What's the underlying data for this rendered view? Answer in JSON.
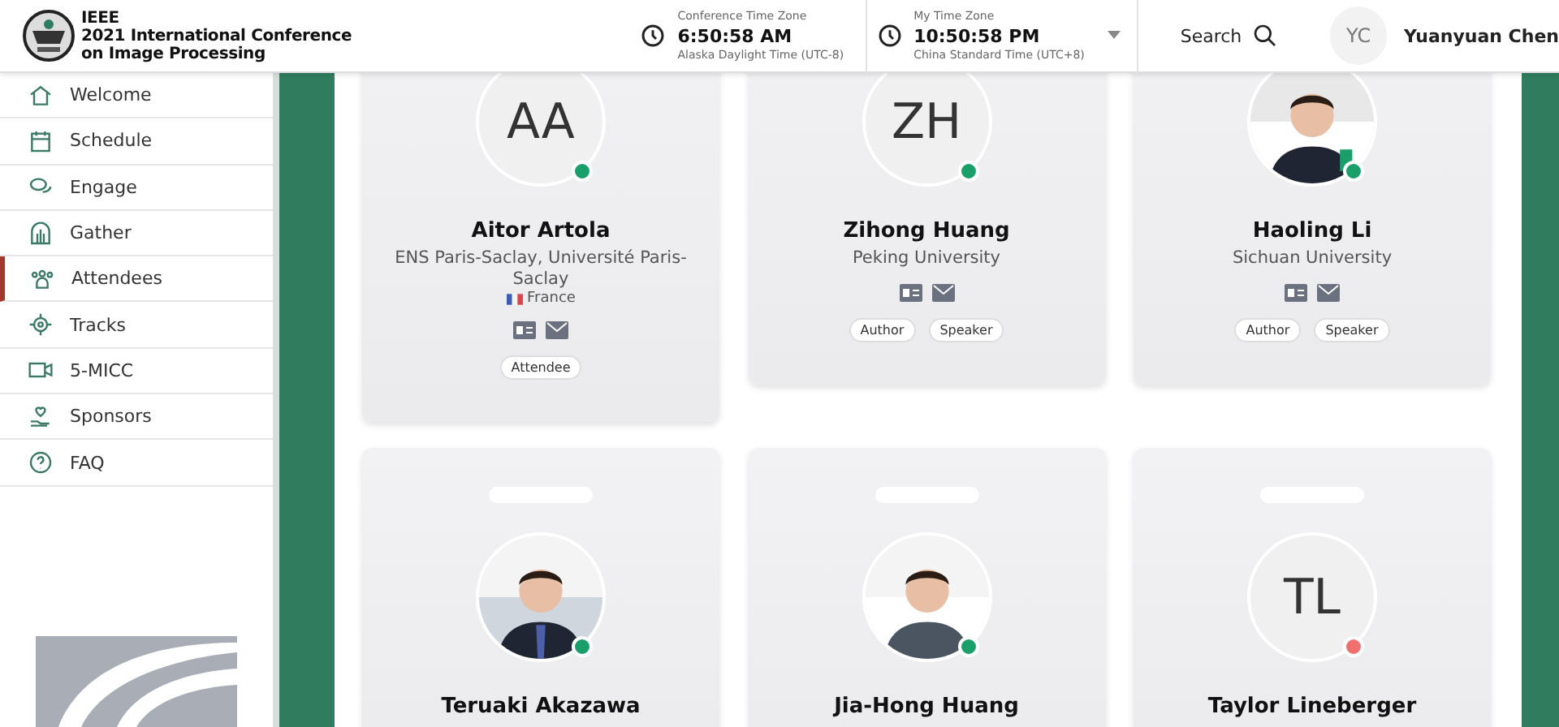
{
  "header": {
    "logo_lines": [
      "IEEE",
      "2021 International Conference",
      "on Image Processing"
    ],
    "clocks": [
      {
        "label": "Conference Time Zone",
        "time": "6:50:58 AM",
        "zone": "Alaska Daylight Time (UTC-8)",
        "dropdown": false
      },
      {
        "label": "My Time Zone",
        "time": "10:50:58 PM",
        "zone": "China Standard Time (UTC+8)",
        "dropdown": true
      }
    ],
    "search": "Search",
    "user": {
      "initials": "YC",
      "name": "Yuanyuan Chen"
    }
  },
  "sidebar": {
    "items": [
      {
        "label": "Welcome",
        "selected": false
      },
      {
        "label": "Schedule",
        "selected": false
      },
      {
        "label": "Engage",
        "selected": false
      },
      {
        "label": "Gather",
        "selected": false
      },
      {
        "label": "Attendees",
        "selected": true
      },
      {
        "label": "Tracks",
        "selected": false
      },
      {
        "label": "5-MICC",
        "selected": false
      },
      {
        "label": "Sponsors",
        "selected": false
      },
      {
        "label": "FAQ",
        "selected": false
      }
    ]
  },
  "attendees": [
    {
      "name": "Aitor Artola",
      "avatar": {
        "kind": "initials",
        "initials": "AA"
      },
      "color": "#1a9e6a",
      "affiliation": "ENS Paris-Saclay, Université Paris-Saclay",
      "country": "France",
      "roles": [
        "Attendee"
      ]
    },
    {
      "name": "Zihong Huang",
      "avatar": {
        "kind": "initials",
        "initials": "ZH"
      },
      "color": "#1a9e6a",
      "affiliation": "Peking University",
      "roles": [
        "Author",
        "Speaker"
      ]
    },
    {
      "name": "Haoling Li",
      "avatar": {
        "kind": "picture"
      },
      "color": "#1a9e6a",
      "affiliation": "Sichuan University",
      "roles": [
        "Author",
        "Speaker"
      ]
    },
    {
      "name": "Teruaki Akazawa",
      "avatar": {
        "kind": "picture"
      },
      "color": "#1a9e6a"
    },
    {
      "name": "Jia-Hong Huang",
      "avatar": {
        "kind": "picture"
      },
      "color": "#1a9e6a"
    },
    {
      "name": "Taylor Lineberger",
      "avatar": {
        "kind": "initials",
        "initials": "TL"
      },
      "color": "#f07070"
    }
  ]
}
